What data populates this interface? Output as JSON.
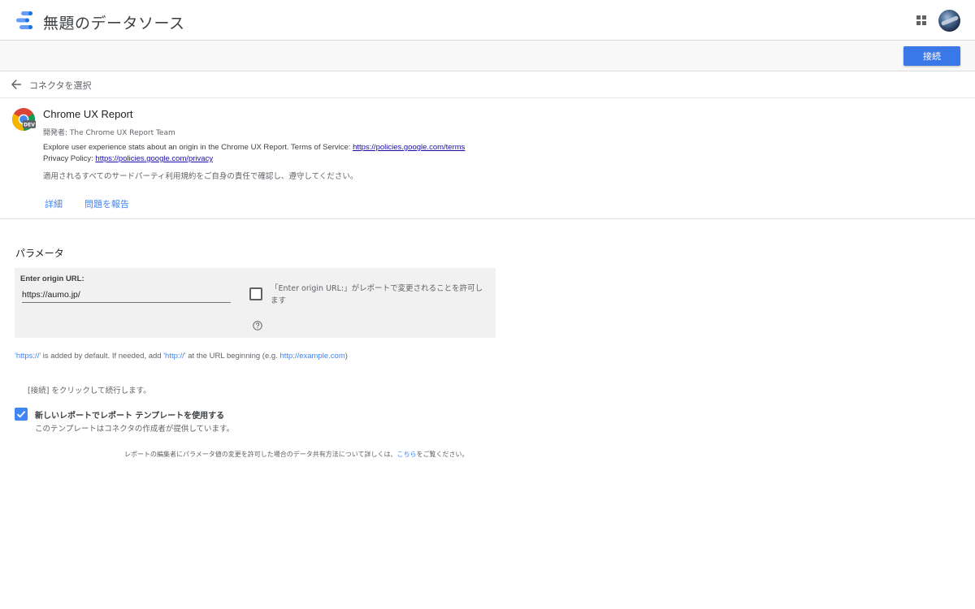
{
  "header": {
    "title": "無題のデータソース",
    "logo_icon": "data-studio-logo-icon",
    "apps_icon": "apps-grid-icon",
    "avatar_icon": "user-avatar"
  },
  "toolbar": {
    "connect_label": "接続"
  },
  "nav": {
    "back_label": "コネクタを選択"
  },
  "connector": {
    "name": "Chrome UX Report",
    "developer": "開発者: The Chrome UX Report Team",
    "description": "Explore user experience stats about an origin in the Chrome UX Report. Terms of Service: ",
    "terms_url": "https://policies.google.com/terms",
    "privacy_label": "Privacy Policy: ",
    "privacy_url": "https://policies.google.com/privacy",
    "note": "適用されるすべてのサードパーティ利用規約をご自身の責任で確認し、遵守してください。",
    "details_link": "詳細",
    "report_link": "問題を報告",
    "badge": "DEV"
  },
  "parameters": {
    "heading": "パラメータ",
    "origin_label": "Enter origin URL:",
    "origin_value": "https://aumo.jp/",
    "allow_change_label": "「Enter origin URL:」がレポートで変更されることを許可します",
    "allow_change_checked": false
  },
  "info": {
    "part1": "'https://'",
    "part2": " is added by default. If needed, add ",
    "part3": "'http://'",
    "part4": " at the URL beginning (e.g. ",
    "part5": "http://example.com",
    "part6": ")"
  },
  "continue_note": "[接続] をクリックして続行します。",
  "template": {
    "label": "新しいレポートでレポート テンプレートを使用する",
    "sub": "このテンプレートはコネクタの作成者が提供しています。",
    "checked": true
  },
  "footnote": {
    "text": "レポートの編集者にパラメータ値の変更を許可した場合のデータ共有方法について詳しくは、",
    "link": "こちら",
    "suffix": "をご覧ください。"
  },
  "colors": {
    "accent": "#3b78e7",
    "link": "#4285f4",
    "checkbox_on": "#4285f4"
  }
}
